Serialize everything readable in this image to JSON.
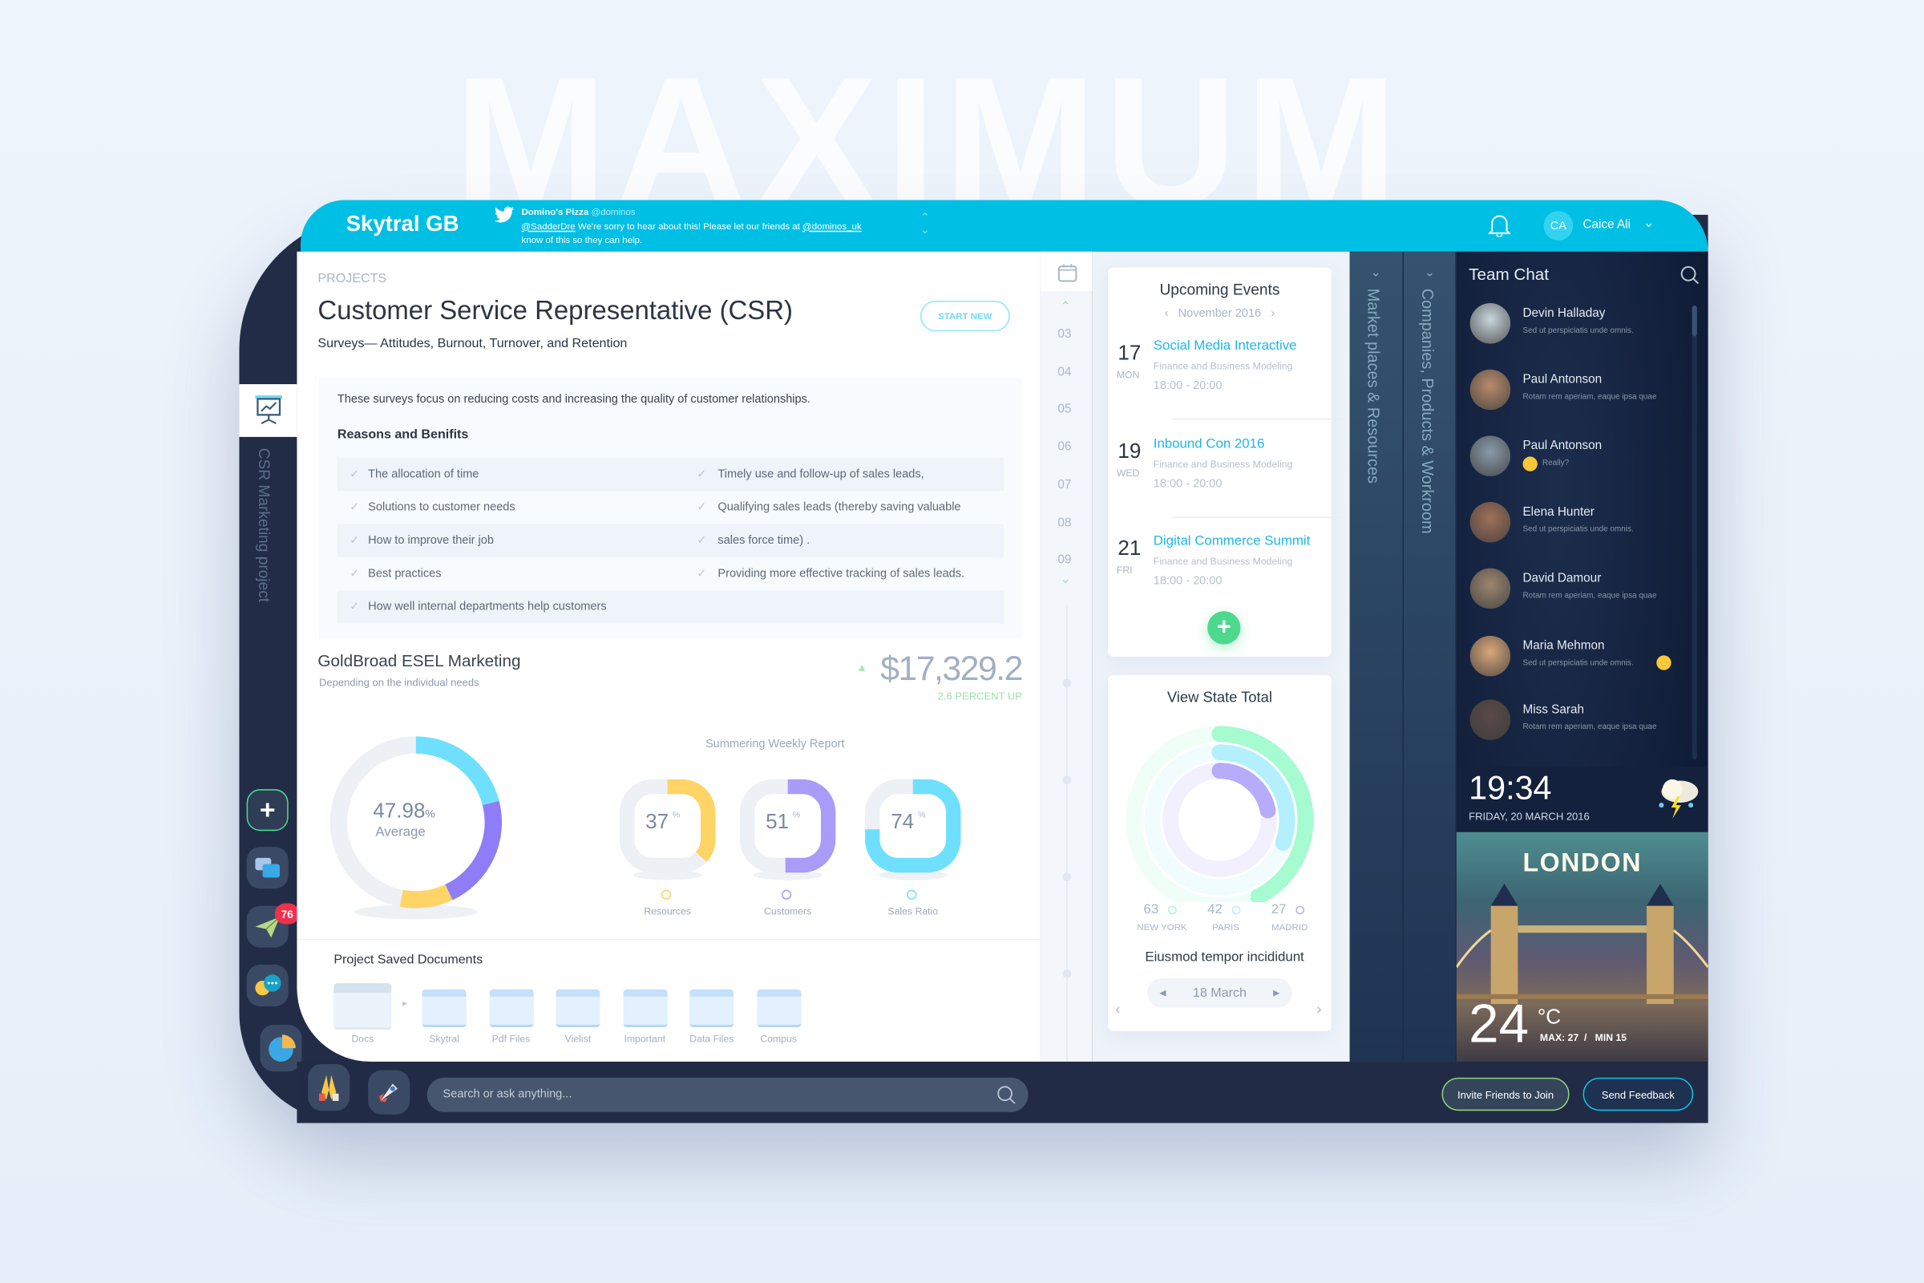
{
  "watermark": "MAXIMUM",
  "header": {
    "brand": "Skytral GB",
    "tweet": {
      "author": "Domino's Pizza",
      "handle": "@dominos",
      "mention": "@SadderDre",
      "text1": " We're sorry to hear about this! Please let our friends at ",
      "mention2": "@dominos_uk",
      "text2": "know of this so they can help."
    },
    "user_initials": "CA",
    "user_name": "Caice Ali"
  },
  "sidebar": {
    "project_label": "CSR Marketing project",
    "badge_count": "76"
  },
  "main": {
    "section": "PROJECTS",
    "title": "Customer Service Representative (CSR)",
    "start_new": "START NEW",
    "subtitle": "Surveys— Attitudes, Burnout, Turnover, and Retention",
    "intro": "These surveys focus on reducing costs and increasing the quality of customer relationships.",
    "reasons_title": "Reasons and Benifits",
    "reasons_left": [
      "The allocation of time",
      "Solutions to customer needs",
      "How to improve their job",
      "Best practices",
      "How well internal departments help customers"
    ],
    "reasons_right": [
      "Timely use and follow-up of sales leads,",
      "Qualifying sales leads (thereby saving valuable",
      "sales force time) .",
      "Providing more effective tracking of sales leads."
    ],
    "marketing": {
      "title": "GoldBroad ESEL Marketing",
      "subtitle": "Depending on the individual needs",
      "amount": "$17,329.2",
      "change": "2.6 PERCENT UP"
    },
    "average": {
      "value": "47.98",
      "unit": "%",
      "label": "Average",
      "segments": [
        {
          "color": "#6ee0fd",
          "share": 0.21
        },
        {
          "color": "#8f7cf7",
          "share": 0.22
        },
        {
          "color": "#ffd466",
          "share": 0.1
        }
      ]
    },
    "weekly": {
      "title": "Summering Weekly Report",
      "gauges": [
        {
          "value": 37,
          "label": "Resources",
          "color": "#ffd466"
        },
        {
          "value": 51,
          "label": "Customers",
          "color": "#a89cf8"
        },
        {
          "value": 74,
          "label": "Sales Ratio",
          "color": "#6ee0fd"
        }
      ]
    },
    "documents": {
      "title": "Project Saved Documents",
      "folders": [
        "Docs",
        "Skytral",
        "Pdf Files",
        "Vielist",
        "Important",
        "Data Files",
        "Compus"
      ]
    }
  },
  "timeline": {
    "hours": [
      "03",
      "04",
      "05",
      "06",
      "07",
      "08",
      "09"
    ]
  },
  "events": {
    "title": "Upcoming Events",
    "month": "November 2016",
    "items": [
      {
        "day": "17",
        "weekday": "MON",
        "title": "Social Media Interactive",
        "subtitle": "Finance and Business Modeling",
        "time": "18:00 - 20:00"
      },
      {
        "day": "19",
        "weekday": "WED",
        "title": "Inbound Con 2016",
        "subtitle": "Finance and Business Modeling",
        "time": "18:00 - 20:00"
      },
      {
        "day": "21",
        "weekday": "FRI",
        "title": "Digital Commerce Summit",
        "subtitle": "Finance and Business Modeling",
        "time": "18:00 - 20:00"
      }
    ]
  },
  "view_state": {
    "title": "View State Total",
    "cities": [
      {
        "value": 63,
        "name": "NEW YORK",
        "color": "#a6fbd0"
      },
      {
        "value": 42,
        "name": "PARIS",
        "color": "#b3effd"
      },
      {
        "value": 27,
        "name": "MADRID",
        "color": "#b6acf9"
      }
    ],
    "caption": "Eiusmod tempor incididunt",
    "date": "18 March"
  },
  "tabs": [
    "Market places & Resources",
    "Companies, Products & Workroom"
  ],
  "chat": {
    "title": "Team Chat",
    "items": [
      {
        "name": "Devin Halladay",
        "msg": "Sed ut perspiciatis unde omnis."
      },
      {
        "name": "Paul Antonson",
        "msg": "Rotam rem aperiam, eaque ipsa quae"
      },
      {
        "name": "Paul Antonson",
        "msg": "Really?"
      },
      {
        "name": "Elena Hunter",
        "msg": "Sed ut perspiciatis unde omnis."
      },
      {
        "name": "David Damour",
        "msg": "Rotam rem aperiam, eaque ipsa quae"
      },
      {
        "name": "Maria Mehmon",
        "msg": "Sed ut perspiciatis unde omnis."
      },
      {
        "name": "Miss Sarah",
        "msg": "Rotam rem aperiam, eaque ipsa quae"
      }
    ]
  },
  "weather": {
    "time": "19:34",
    "date": "FRIDAY, 20 MARCH 2016",
    "city": "LONDON",
    "temp": "24",
    "unit": "°C",
    "maxmin": "MAX: 27  /   MIN 15"
  },
  "bottom": {
    "search_placeholder": "Search or ask anything...",
    "invite": "Invite Friends to Join",
    "feedback": "Send Feedback"
  }
}
